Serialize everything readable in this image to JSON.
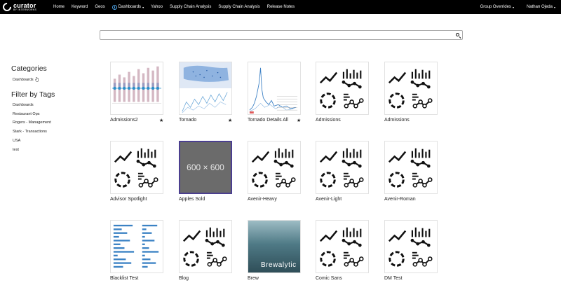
{
  "app": {
    "logo_name": "curator",
    "logo_sub": "BY INTERWORKS"
  },
  "nav": {
    "items": [
      "Home",
      "Keyword",
      "Geos",
      "Dashboards",
      "Yahoo",
      "Supply Chain Analysis",
      "Supply Chain Analysis",
      "Release Notes"
    ],
    "group_overrides": "Group Overrides",
    "user": "Nathan Ojeda",
    "caret": "▾"
  },
  "search": {
    "placeholder": "",
    "icon": "search-icon"
  },
  "sidebar": {
    "categories_heading": "Categories",
    "categories": [
      "Dashboards"
    ],
    "tags_heading": "Filter by Tags",
    "tags": [
      "Dashboards",
      "Restaurant Ops",
      "Rogers - Management",
      "Stark - Transactions",
      "USA",
      "test"
    ]
  },
  "dashboards": [
    {
      "title": "Admissions2",
      "thumb": "chart-thumbnail",
      "starred": true
    },
    {
      "title": "Tornado",
      "thumb": "map-thumbnail",
      "starred": true
    },
    {
      "title": "Tornado Details All",
      "thumb": "line-thumbnail",
      "starred": true
    },
    {
      "title": "Admissions",
      "thumb": "default-icon",
      "starred": false
    },
    {
      "title": "Admissions",
      "thumb": "default-icon",
      "starred": false
    },
    {
      "title": "Advisor Spotlight",
      "thumb": "default-icon",
      "starred": false
    },
    {
      "title": "Apples Sold",
      "thumb": "placeholder",
      "placeholder_text": "600 × 600",
      "starred": false
    },
    {
      "title": "Avenir-Heavy",
      "thumb": "default-icon",
      "starred": false
    },
    {
      "title": "Avenir-Light",
      "thumb": "default-icon",
      "starred": false
    },
    {
      "title": "Avenir-Roman",
      "thumb": "default-icon",
      "starred": false
    },
    {
      "title": "Blacklist Test",
      "thumb": "table-thumbnail",
      "starred": false
    },
    {
      "title": "Blog",
      "thumb": "default-icon",
      "starred": false
    },
    {
      "title": "Brew",
      "thumb": "photo-thumbnail",
      "overlay_text": "Brewalytic",
      "starred": false
    },
    {
      "title": "Comic Sans",
      "thumb": "default-icon",
      "starred": false
    },
    {
      "title": "DM Test",
      "thumb": "default-icon",
      "starred": false
    }
  ],
  "star_glyph": "★",
  "colors": {
    "topbar": "#000000",
    "accent": "#4ea3e6",
    "placeholder_border": "#4b3f8f"
  }
}
